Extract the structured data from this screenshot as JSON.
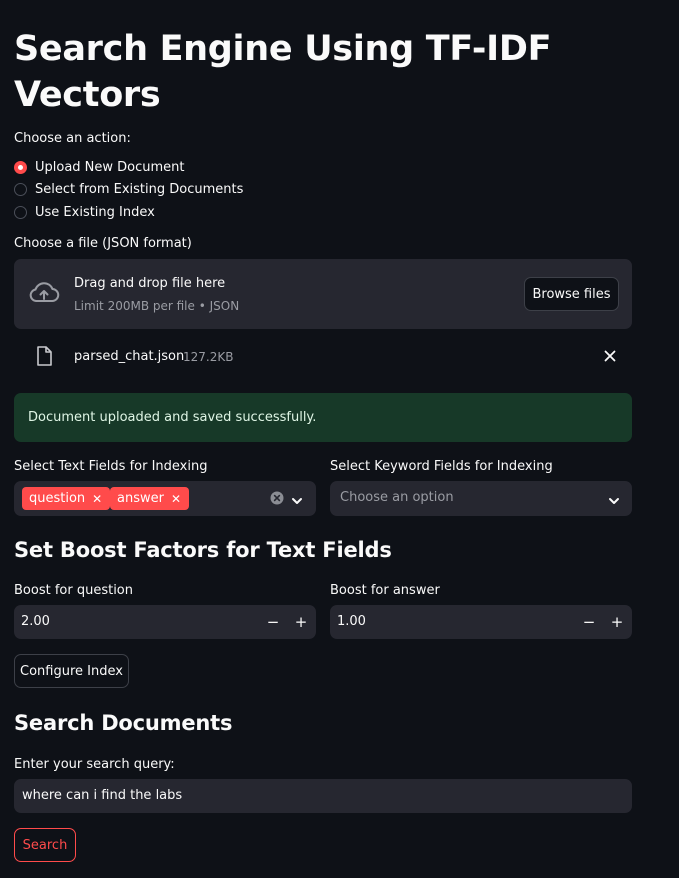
{
  "title": "Search Engine Using TF-IDF Vectors",
  "action": {
    "label": "Choose an action:",
    "options": [
      "Upload New Document",
      "Select from Existing Documents",
      "Use Existing Index"
    ],
    "selected": "Upload New Document"
  },
  "uploader": {
    "label": "Choose a file (JSON format)",
    "drag_text": "Drag and drop file here",
    "limit_text": "Limit 200MB per file • JSON",
    "browse_label": "Browse files",
    "file_name": "parsed_chat.json",
    "file_size": "127.2KB"
  },
  "success_message": "Document uploaded and saved successfully.",
  "text_fields": {
    "label": "Select Text Fields for Indexing",
    "selected": [
      "question",
      "answer"
    ]
  },
  "keyword_fields": {
    "label": "Select Keyword Fields for Indexing",
    "placeholder": "Choose an option"
  },
  "boost": {
    "heading": "Set Boost Factors for Text Fields",
    "question_label": "Boost for question",
    "question_value": "2.00",
    "answer_label": "Boost for answer",
    "answer_value": "1.00",
    "minus": "−",
    "plus": "+"
  },
  "configure_label": "Configure Index",
  "search": {
    "heading": "Search Documents",
    "query_label": "Enter your search query:",
    "query_value": "where can i find the labs",
    "button_label": "Search"
  },
  "colors": {
    "background": "#0e1117",
    "surface": "#262730",
    "accent": "#ff4b4b",
    "success_bg": "#173928"
  }
}
